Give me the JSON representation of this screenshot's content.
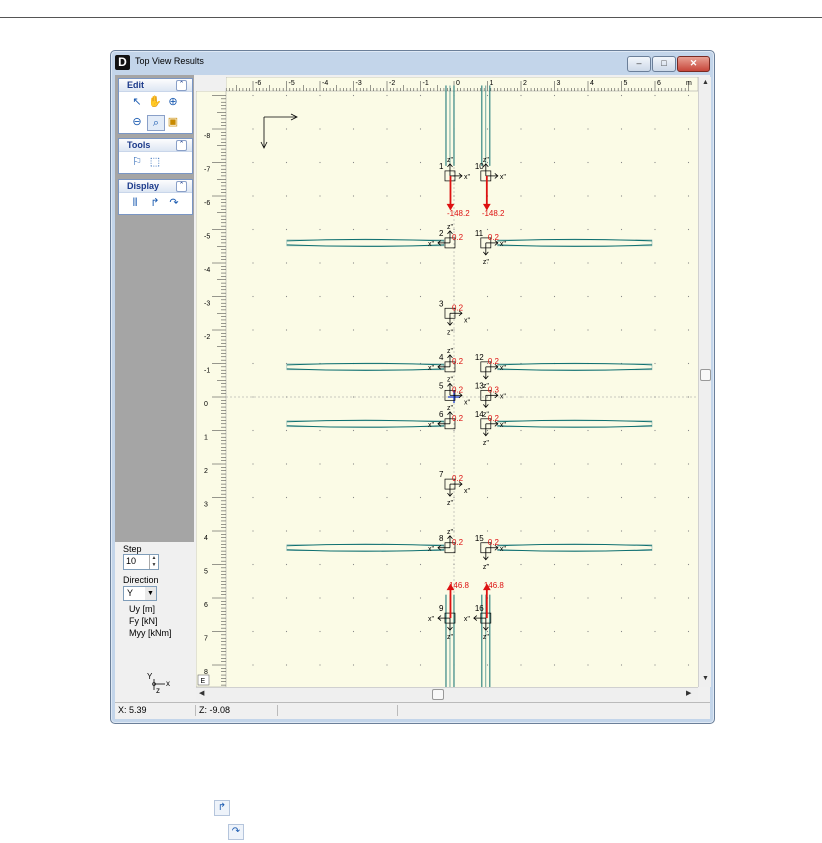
{
  "window": {
    "title": "Top View Results"
  },
  "panel": {
    "groups": [
      {
        "label": "Edit"
      },
      {
        "label": "Tools"
      },
      {
        "label": "Display"
      }
    ],
    "step": {
      "label": "Step",
      "value": "10"
    },
    "direction": {
      "label": "Direction",
      "value": "Y"
    },
    "legend": [
      "Uy [m]",
      "Fy [kN]",
      "Myy [kNm]"
    ],
    "axes_label_y": "Y",
    "axes_label_z": "z",
    "axes_label_x": "x"
  },
  "status": {
    "x": "X: 5.39",
    "z": "Z: -9.08"
  },
  "canvas": {
    "top_ruler_labels": [
      "-6",
      "-5",
      "-4",
      "-3",
      "-2",
      "-1",
      "0",
      "1",
      "2",
      "3",
      "4",
      "5",
      "6"
    ],
    "top_ruler_unit": "m",
    "left_ruler_labels": [
      "-8",
      "-7",
      "-6",
      "-5",
      "-4",
      "-3",
      "-2",
      "-1",
      "0",
      "1",
      "2",
      "3",
      "4",
      "5",
      "6",
      "7",
      "8"
    ],
    "corner_button": "E",
    "nodes": [
      {
        "id": "1",
        "value": "-148.2"
      },
      {
        "id": "10",
        "value": "-148.2"
      },
      {
        "id": "2",
        "value": "0.2"
      },
      {
        "id": "11",
        "value": "0.2"
      },
      {
        "id": "3",
        "value": "0.2"
      },
      {
        "id": "4",
        "value": "0.2"
      },
      {
        "id": "12",
        "value": "0.2"
      },
      {
        "id": "5",
        "value": "0.2"
      },
      {
        "id": "13",
        "value": "0.3"
      },
      {
        "id": "6",
        "value": "0.2"
      },
      {
        "id": "14",
        "value": "0.2"
      },
      {
        "id": "7",
        "value": "0.2"
      },
      {
        "id": "8",
        "value": "0.2"
      },
      {
        "id": "15",
        "value": "0.2"
      },
      {
        "id": "9",
        "value": "146.8"
      },
      {
        "id": "16",
        "value": "146.8"
      }
    ],
    "local_axis_x": "x''",
    "local_axis_z": "z''"
  },
  "colors": {
    "canvas_bg": "#fbfbe6",
    "member": "#0f7070",
    "force": "#dd1111",
    "accent": "#1c3a8a"
  }
}
